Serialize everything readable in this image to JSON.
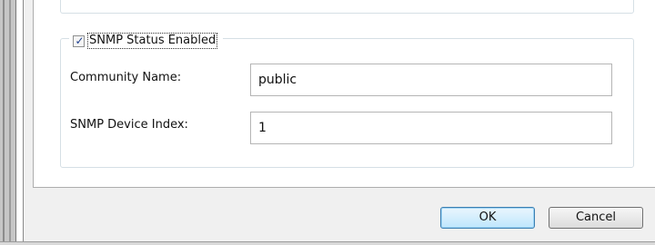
{
  "snmp": {
    "enabled_label": "SNMP Status Enabled",
    "enabled": true,
    "community_label": "Community Name:",
    "community_value": "public",
    "device_index_label": "SNMP Device Index:",
    "device_index_value": "1"
  },
  "buttons": {
    "ok": "OK",
    "cancel": "Cancel"
  }
}
